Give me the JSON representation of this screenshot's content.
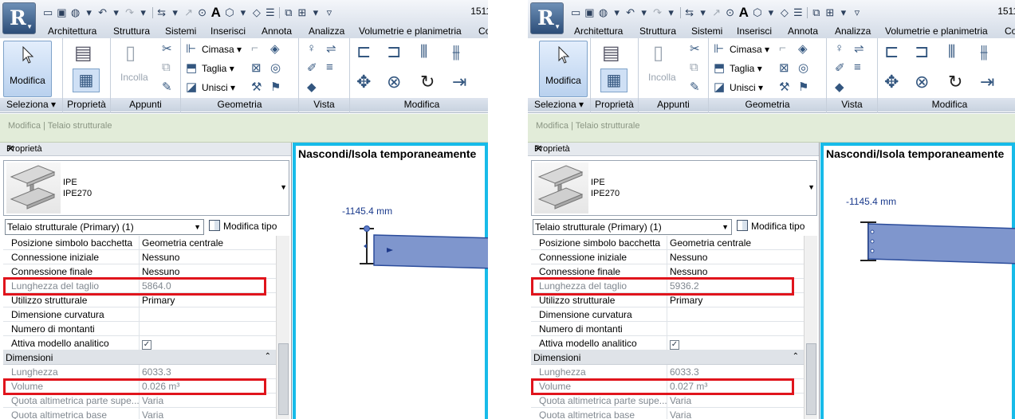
{
  "ribbon": {
    "app_letter": "R",
    "quick_access_number": "1511",
    "tabs": [
      "Architettura",
      "Struttura",
      "Sistemi",
      "Inserisci",
      "Annota",
      "Analizza",
      "Volumetrie e planimetria",
      "Co"
    ],
    "modify_label": "Modifica",
    "incolla_label": "Incolla",
    "cimasa_label": "Cimasa",
    "taglia_label": "Taglia",
    "unisci_label": "Unisci",
    "panels": {
      "seleziona": "Seleziona",
      "proprieta": "Proprietà",
      "appunti": "Appunti",
      "geometria": "Geometria",
      "vista": "Vista",
      "modifica": "Modifica"
    }
  },
  "context_bar": "Modifica | Telaio strutturale",
  "properties": {
    "title": "Proprietà",
    "type_family": "IPE",
    "type_name": "IPE270",
    "selector": "Telaio strutturale (Primary) (1)",
    "edit_type": "Modifica tipo",
    "group_label": "Dimensioni",
    "labels": {
      "posizione": "Posizione simbolo bacchetta",
      "conn_iniziale": "Connessione iniziale",
      "conn_finale": "Connessione finale",
      "lunghezza_taglio": "Lunghezza del taglio",
      "utilizzo": "Utilizzo strutturale",
      "dimensione_curvatura": "Dimensione curvatura",
      "numero_montanti": "Numero di montanti",
      "attiva_modello": "Attiva modello analitico",
      "lunghezza": "Lunghezza",
      "volume": "Volume",
      "quota_superiore": "Quota altimetrica parte supe...",
      "quota_base": "Quota altimetrica base"
    },
    "values": {
      "posizione": "Geometria centrale",
      "conn_iniziale": "Nessuno",
      "conn_finale": "Nessuno",
      "utilizzo": "Primary",
      "lunghezza": "6033.3",
      "quota_superiore": "Varia",
      "quota_base": "Varia",
      "attiva_modello": "✓"
    }
  },
  "view": {
    "title": "Nascondi/Isola temporaneamente"
  },
  "left": {
    "lunghezza_taglio": "5864.0",
    "volume": "0.026 m³",
    "dimension": "-1145.4 mm"
  },
  "right": {
    "lunghezza_taglio": "5936.2",
    "volume": "0.027 m³",
    "dimension": "-1145.4 mm"
  },
  "colors": {
    "highlight": "#e0141c",
    "view_border": "#17bbe9",
    "beam_fill": "#7f96cd",
    "context_bar": "#e2ecd9"
  }
}
